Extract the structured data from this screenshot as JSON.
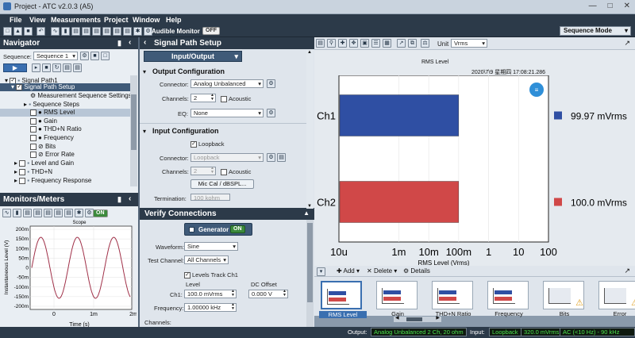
{
  "window": {
    "title": "Project - ATC v2.0.3 (A5)"
  },
  "menu": [
    "File",
    "View",
    "Measurements",
    "Project",
    "Window",
    "Help"
  ],
  "toolbar": {
    "audible_monitor": "Audible Monitor",
    "audible_state": "OFF",
    "sequence_mode": "Sequence Mode"
  },
  "navigator": {
    "title": "Navigator",
    "sequence_label": "Sequence:",
    "sequence_value": "Sequence 1",
    "tree": [
      "Signal Path1",
      "Signal Path Setup",
      "Measurement Sequence Settings...",
      "Sequence Steps",
      "RMS Level",
      "Gain",
      "THD+N Ratio",
      "Frequency",
      "Bits",
      "Error Rate",
      "Level and Gain",
      "THD+N",
      "Frequency Response"
    ]
  },
  "monitors": {
    "title": "Monitors/Meters",
    "on_label": "ON",
    "scope": {
      "title": "Scope",
      "ylabel": "Instantaneous Level (V)",
      "xlabel": "Time (s)",
      "yticks": [
        "200m",
        "150m",
        "100m",
        "50m",
        "0",
        "-50m",
        "-100m",
        "-150m",
        "-200m"
      ],
      "xticks": [
        "0",
        "1m",
        "2m"
      ]
    }
  },
  "sps": {
    "title": "Signal Path Setup",
    "mode": "Input/Output",
    "output_title": "Output Configuration",
    "connector_label": "Connector:",
    "connector_value": "Analog Unbalanced",
    "channels_label": "Channels:",
    "channels_value": "2",
    "acoustic_label": "Acoustic",
    "eq_label": "EQ:",
    "eq_value": "None",
    "input_title": "Input Configuration",
    "loopback_label": "Loopback",
    "in_connector_value": "Loopback",
    "in_channels_value": "2",
    "mic_cal": "Mic Cal / dBSPL...",
    "termination_label": "Termination:",
    "termination_value": "100 kohm"
  },
  "verify": {
    "title": "Verify Connections",
    "generator": "Generator",
    "gen_state": "ON",
    "waveform_label": "Waveform:",
    "waveform_value": "Sine",
    "test_channel_label": "Test Channel:",
    "test_channel_value": "All Channels",
    "levels_track": "Levels Track Ch1",
    "level_header": "Level",
    "dc_header": "DC Offset",
    "ch1_label": "Ch1:",
    "ch1_level": "100.0 mVrms",
    "ch1_dc": "0.000 V",
    "frequency_label": "Frequency:",
    "frequency_value": "1.00000 kHz",
    "channels_label": "Channels:"
  },
  "graph": {
    "unit_label": "Unit",
    "unit_value": "Vrms",
    "title": "RMS Level",
    "timestamp": "2020\\7\\9 星期四  17:08:21.286",
    "xlabel": "RMS Level (Vrms)"
  },
  "chart_data": {
    "type": "bar",
    "orientation": "horizontal",
    "categories": [
      "Ch1",
      "Ch2"
    ],
    "values": [
      0.09997,
      0.1
    ],
    "value_labels": [
      "99.97  mVrms",
      "100.0  mVrms"
    ],
    "colors": [
      "#2f4fa3",
      "#d04848"
    ],
    "xticks": [
      "10u",
      "1m",
      "10m",
      "100m",
      "1",
      "10",
      "100"
    ],
    "xscale": "log",
    "xlim": [
      1e-05,
      100
    ],
    "xlabel": "RMS Level (Vrms)"
  },
  "results": {
    "add": "Add",
    "delete": "Delete",
    "details": "Details",
    "items": [
      "RMS Level",
      "Gain",
      "THD+N Ratio",
      "Frequency",
      "Bits",
      "Error"
    ]
  },
  "status": {
    "output_label": "Output:",
    "output_value": "Analog Unbalanced 2 Ch, 20 ohm",
    "input_label": "Input:",
    "input_value": "Loopback",
    "input_level": "320.0 mVrms",
    "input_range": "AC (<10 Hz) - 90 kHz"
  }
}
